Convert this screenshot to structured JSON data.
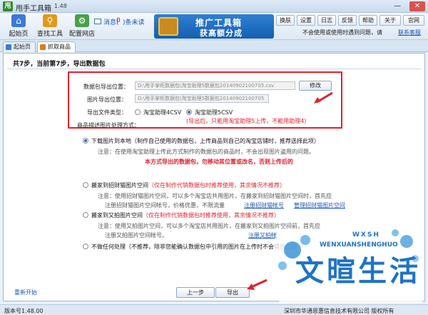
{
  "window": {
    "title": "甩手工具箱",
    "version": "1.48",
    "min": "—",
    "close": "✕"
  },
  "toolbar": {
    "home": "起始页",
    "find": "查找工具",
    "config": "配置网店",
    "msg_label": "消息(",
    "msg_count": "0",
    "msg_unread": ")条未读",
    "banner_line1": "推广工具箱",
    "banner_line2": "获高额分成",
    "skin": "换肤",
    "settings": "设置",
    "log": "日志",
    "feedback": "反馈",
    "help": "帮助",
    "about": "关于",
    "site": "官网",
    "auto_login": "不会使用或使用时遇到问题，请",
    "contact": "联系客服"
  },
  "tabs": [
    {
      "label": "起始页"
    },
    {
      "label": "抓取商品"
    }
  ],
  "step": {
    "title": "共7步，当前第7步，导出数据包"
  },
  "form": {
    "pkg_label": "数据包导出位置：",
    "pkg_value": "D:\\甩手掌柜数据包\\淘宝助理5数据包20140902100705.csv",
    "img_label": "图片导出位置：",
    "img_value": "D:\\甩手掌柜数据包\\淘宝助理5数据包20140902100705",
    "modify": "修改",
    "ftype_label": "导出文件类型：",
    "ftype_opt1": "淘宝助理4CSV",
    "ftype_opt2": "淘宝助理5CSV",
    "ftype_note": "(导出后，只能用淘宝助理5上传，不能用助理4)",
    "img_handle_label": "商品描述图片处理方式："
  },
  "options": {
    "o1": "下载图片到本地（制作自己使用的数据包，上传商品到自己的淘宝店铺时，推荐选择此项）",
    "o1_note": "注意：在使用淘宝助理上传此方式制作的数据包的商品时，不会出现图片盗用的问题。",
    "o1_warn": "本方式导出的数据包，勿移动其位置或改名，否则上传后的",
    "o2_a": "搬家到招财猫图片空间",
    "o2_b": "（仅在制作代销数据包时推荐使用，其余情况不推荐）",
    "o2_note1": "注意：使用招财猫图片空间，可以多个淘宝店共用图片，在搬家到招财猫图片空间时，首先应",
    "o2_note2": "注册招财猫图片空间帐号，价格优惠，不限流量",
    "o2_link1": "注册招财猫帐号",
    "o2_link2": "管理招财猫图片空间",
    "o3_a": "搬家到又拍图片空间",
    "o3_b": "（仅在制作代销数据包时推荐使用，其余情况不推荐）",
    "o3_note1": "注意：使用又拍图片空间，可以多个淘宝店共用图片，在搬家到又拍图片空间前，首先应",
    "o3_note2": "注册又拍图片空间帐号。",
    "o3_link": "注册又拍帐",
    "o4": "不做任何处理（不推荐，除非您能确认数据包中引用的图片在上传时不会提示盗链"
  },
  "nav": {
    "restart": "重新开始",
    "prev": "上一步",
    "export": "导出"
  },
  "status": {
    "version": "版本号1.48.00",
    "copyright": "深圳市华通恩惠信息技术有限公司 版权所有"
  },
  "watermark": {
    "sub": "WENXUANSHENGHUO",
    "small": "WXSH",
    "main": "文暄生活"
  }
}
